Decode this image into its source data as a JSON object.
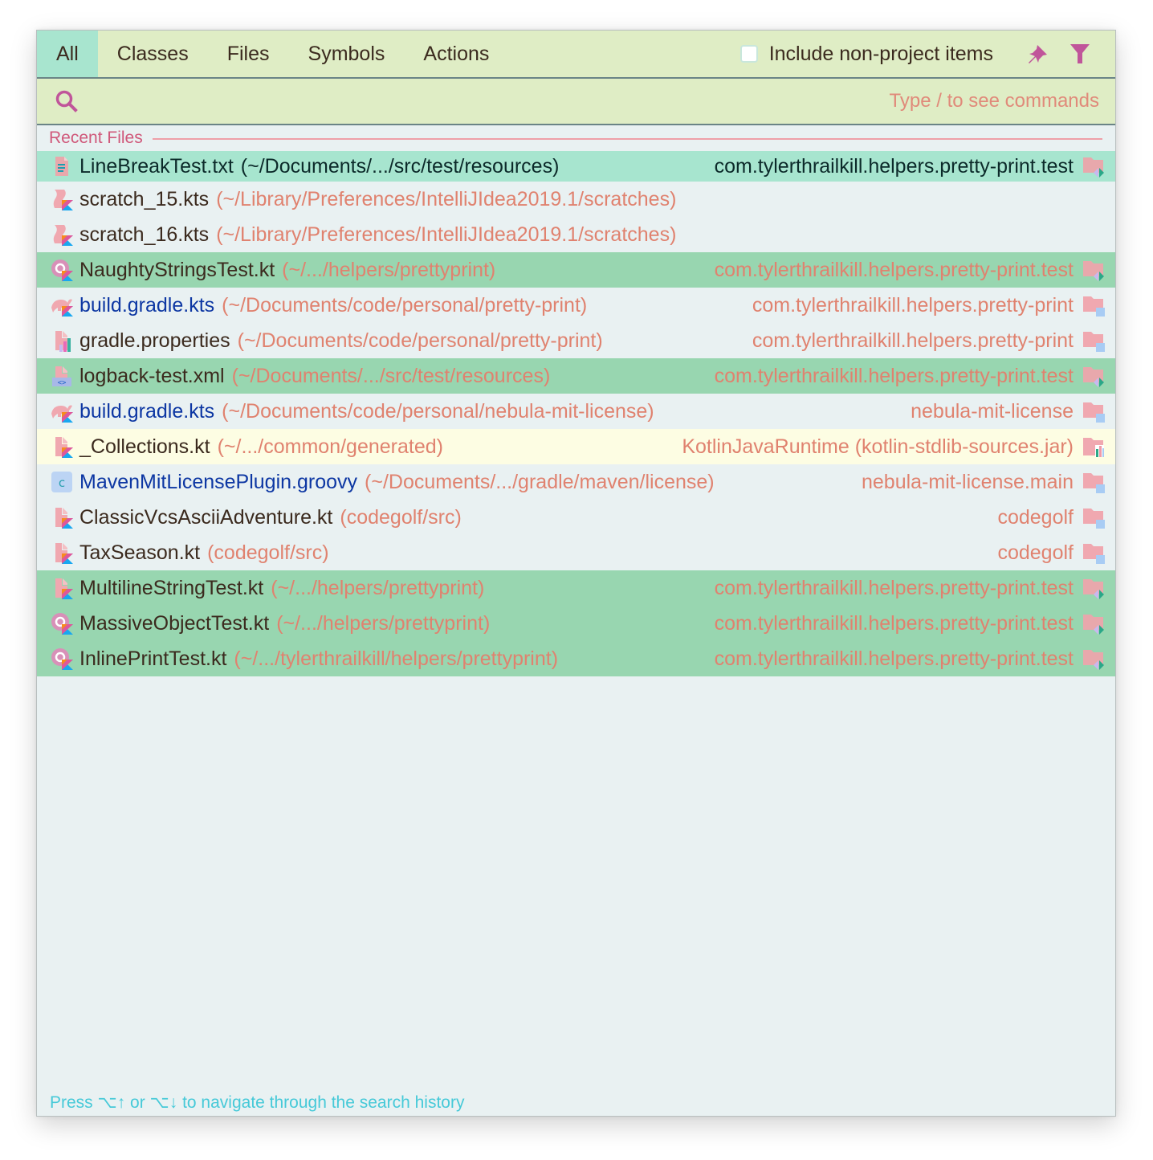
{
  "tabs": [
    {
      "label": "All",
      "active": true
    },
    {
      "label": "Classes",
      "active": false
    },
    {
      "label": "Files",
      "active": false
    },
    {
      "label": "Symbols",
      "active": false
    },
    {
      "label": "Actions",
      "active": false
    }
  ],
  "options": {
    "include_non_project_label": "Include non-project items",
    "include_non_project_checked": false,
    "pin_icon": "pin-icon",
    "filter_icon": "filter-icon"
  },
  "search": {
    "value": "",
    "placeholder": "",
    "hint": "Type / to see commands",
    "icon": "search-icon"
  },
  "section": {
    "title": "Recent Files"
  },
  "files": [
    {
      "name": "LineBreakTest.txt",
      "path": "(~/Documents/.../src/test/resources)",
      "module": "com.tylerthrailkill.helpers.pretty-print.test",
      "icon": "text-file-icon",
      "module_icon": "test-folder-icon",
      "state": "selected",
      "name_color": "dark"
    },
    {
      "name": "scratch_15.kts",
      "path": "(~/Library/Preferences/IntelliJIdea2019.1/scratches)",
      "module": "",
      "icon": "kotlin-script-icon",
      "module_icon": "",
      "state": "normal",
      "name_color": "dark"
    },
    {
      "name": "scratch_16.kts",
      "path": "(~/Library/Preferences/IntelliJIdea2019.1/scratches)",
      "module": "",
      "icon": "kotlin-script-icon",
      "module_icon": "",
      "state": "normal",
      "name_color": "dark"
    },
    {
      "name": "NaughtyStringsTest.kt",
      "path": "(~/.../helpers/prettyprint)",
      "module": "com.tylerthrailkill.helpers.pretty-print.test",
      "icon": "kotlin-class-icon",
      "module_icon": "test-folder-icon",
      "state": "test",
      "name_color": "dark"
    },
    {
      "name": "build.gradle.kts",
      "path": "(~/Documents/code/personal/pretty-print)",
      "module": "com.tylerthrailkill.helpers.pretty-print",
      "icon": "gradle-kotlin-icon",
      "module_icon": "module-folder-icon",
      "state": "normal",
      "name_color": "blue"
    },
    {
      "name": "gradle.properties",
      "path": "(~/Documents/code/personal/pretty-print)",
      "module": "com.tylerthrailkill.helpers.pretty-print",
      "icon": "properties-file-icon",
      "module_icon": "module-folder-icon",
      "state": "normal",
      "name_color": "dark"
    },
    {
      "name": "logback-test.xml",
      "path": "(~/Documents/.../src/test/resources)",
      "module": "com.tylerthrailkill.helpers.pretty-print.test",
      "icon": "xml-file-icon",
      "module_icon": "test-folder-icon",
      "state": "test",
      "name_color": "dark"
    },
    {
      "name": "build.gradle.kts",
      "path": "(~/Documents/code/personal/nebula-mit-license)",
      "module": "nebula-mit-license",
      "icon": "gradle-kotlin-icon",
      "module_icon": "module-folder-icon",
      "state": "normal",
      "name_color": "blue"
    },
    {
      "name": "_Collections.kt",
      "path": "(~/.../common/generated)",
      "module": "KotlinJavaRuntime (kotlin-stdlib-sources.jar)",
      "icon": "kotlin-file-icon",
      "module_icon": "library-icon",
      "state": "library",
      "name_color": "dark"
    },
    {
      "name": "MavenMitLicensePlugin.groovy",
      "path": "(~/Documents/.../gradle/maven/license)",
      "module": "nebula-mit-license.main",
      "icon": "groovy-class-icon",
      "module_icon": "module-folder-icon",
      "state": "normal",
      "name_color": "blue"
    },
    {
      "name": "ClassicVcsAsciiAdventure.kt",
      "path": "(codegolf/src)",
      "module": "codegolf",
      "icon": "kotlin-file-icon",
      "module_icon": "module-folder-icon",
      "state": "normal",
      "name_color": "dark"
    },
    {
      "name": "TaxSeason.kt",
      "path": "(codegolf/src)",
      "module": "codegolf",
      "icon": "kotlin-file-icon",
      "module_icon": "module-folder-icon",
      "state": "normal",
      "name_color": "dark"
    },
    {
      "name": "MultilineStringTest.kt",
      "path": "(~/.../helpers/prettyprint)",
      "module": "com.tylerthrailkill.helpers.pretty-print.test",
      "icon": "kotlin-file-icon",
      "module_icon": "test-folder-icon",
      "state": "test",
      "name_color": "dark"
    },
    {
      "name": "MassiveObjectTest.kt",
      "path": "(~/.../helpers/prettyprint)",
      "module": "com.tylerthrailkill.helpers.pretty-print.test",
      "icon": "kotlin-class-icon",
      "module_icon": "test-folder-icon",
      "state": "test",
      "name_color": "dark"
    },
    {
      "name": "InlinePrintTest.kt",
      "path": "(~/.../tylerthrailkill/helpers/prettyprint)",
      "module": "com.tylerthrailkill.helpers.pretty-print.test",
      "icon": "kotlin-class-icon",
      "module_icon": "test-folder-icon",
      "state": "test",
      "name_color": "dark"
    }
  ],
  "footer": {
    "hint": "Press ⌥↑ or ⌥↓ to navigate through the search history"
  },
  "colors": {
    "accent": "#c0559a",
    "tab_active": "#a8e5cf",
    "header_bg": "#dfedc5",
    "selected_row": "#a7e5cf",
    "test_row": "#98d6b0",
    "library_row": "#fdfde3",
    "path_text": "#e0826f",
    "footer_text": "#46c9d8"
  }
}
